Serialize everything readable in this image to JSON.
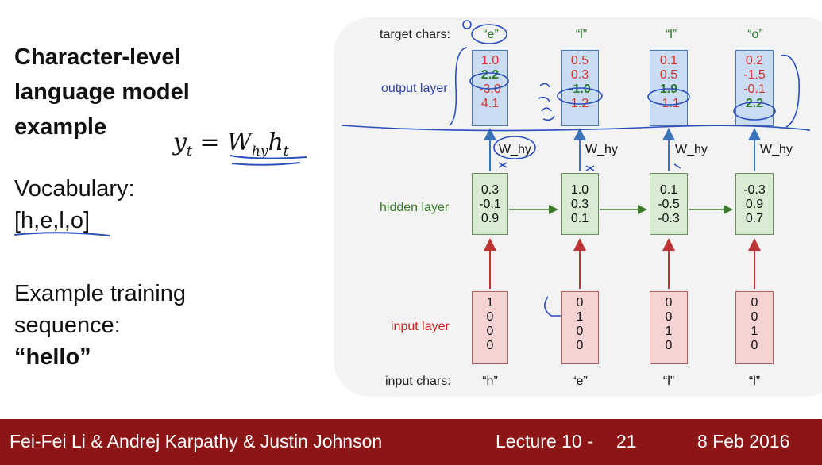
{
  "slide": {
    "title_lines": [
      "Character-level",
      "language model",
      "example"
    ],
    "vocab_label": "Vocabulary:",
    "vocab_value": "[h,e,l,o]",
    "training_label_1": "Example training",
    "training_label_2": "sequence:",
    "training_value": "“hello”"
  },
  "formula": {
    "lhs": "y",
    "lhs_sub": "t",
    "eq": "=",
    "w": "W",
    "w_sub": "hy",
    "h": "h",
    "h_sub": "t"
  },
  "diagram": {
    "target_label": "target chars:",
    "output_label": "output layer",
    "hidden_label": "hidden layer",
    "input_label": "input layer",
    "input_chars_label": "input chars:",
    "weight_label": "W_hy",
    "target_chars": [
      "“e”",
      "“l”",
      "“l”",
      "“o”"
    ],
    "input_chars": [
      "“h”",
      "“e”",
      "“l”",
      "“l”"
    ],
    "output_vectors": [
      [
        "1.0",
        "2.2",
        "-3.0",
        "4.1"
      ],
      [
        "0.5",
        "0.3",
        "-1.0",
        "1.2"
      ],
      [
        "0.1",
        "0.5",
        "1.9",
        "-1.1"
      ],
      [
        "0.2",
        "-1.5",
        "-0.1",
        "2.2"
      ]
    ],
    "output_highlight_index": [
      1,
      2,
      2,
      3
    ],
    "hidden_vectors": [
      [
        "0.3",
        "-0.1",
        "0.9"
      ],
      [
        "1.0",
        "0.3",
        "0.1"
      ],
      [
        "0.1",
        "-0.5",
        "-0.3"
      ],
      [
        "-0.3",
        "0.9",
        "0.7"
      ]
    ],
    "input_vectors": [
      [
        "1",
        "0",
        "0",
        "0"
      ],
      [
        "0",
        "1",
        "0",
        "0"
      ],
      [
        "0",
        "0",
        "1",
        "0"
      ],
      [
        "0",
        "0",
        "1",
        "0"
      ]
    ],
    "colors": {
      "output": "#c9dcf2",
      "hidden": "#d9ecd3",
      "input": "#f6d3d3",
      "target": "#2a7a2a",
      "output_text": "#d1342d",
      "input_label": "#cc2222",
      "hidden_label": "#3a7a2a",
      "output_label": "#2b3fa8"
    }
  },
  "footer": {
    "authors": "Fei-Fei Li & Andrej Karpathy & Justin Johnson",
    "lecture": "Lecture 10 -",
    "page": "21",
    "date": "8 Feb 2016",
    "bg": "#8c1515"
  }
}
